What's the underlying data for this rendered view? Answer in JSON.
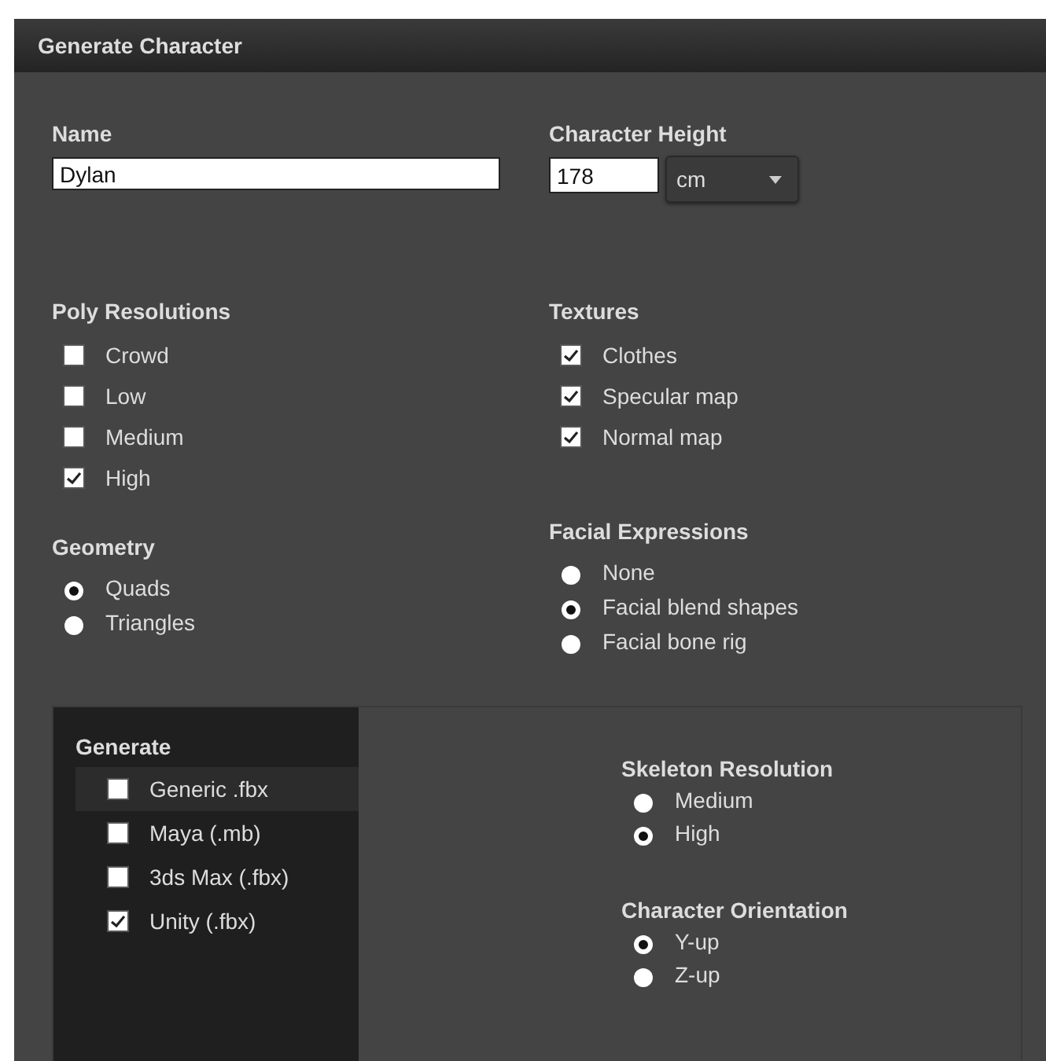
{
  "window": {
    "title": "Generate Character"
  },
  "name": {
    "label": "Name",
    "value": "Dylan"
  },
  "character_height": {
    "label": "Character Height",
    "value": "178",
    "unit": "cm"
  },
  "poly_resolutions": {
    "label": "Poly Resolutions",
    "options": [
      {
        "label": "Crowd",
        "checked": false
      },
      {
        "label": "Low",
        "checked": false
      },
      {
        "label": "Medium",
        "checked": false
      },
      {
        "label": "High",
        "checked": true
      }
    ]
  },
  "textures": {
    "label": "Textures",
    "options": [
      {
        "label": "Clothes",
        "checked": true
      },
      {
        "label": "Specular map",
        "checked": true
      },
      {
        "label": "Normal map",
        "checked": true
      }
    ]
  },
  "geometry": {
    "label": "Geometry",
    "options": [
      {
        "label": "Quads",
        "selected": true
      },
      {
        "label": "Triangles",
        "selected": false
      }
    ]
  },
  "facial_expressions": {
    "label": "Facial Expressions",
    "options": [
      {
        "label": "None",
        "selected": false
      },
      {
        "label": "Facial blend shapes",
        "selected": true
      },
      {
        "label": "Facial bone rig",
        "selected": false
      }
    ]
  },
  "generate": {
    "label": "Generate",
    "items": [
      {
        "label": "Generic .fbx",
        "checked": false,
        "selected": true
      },
      {
        "label": "Maya (.mb)",
        "checked": false,
        "selected": false
      },
      {
        "label": "3ds Max (.fbx)",
        "checked": false,
        "selected": false
      },
      {
        "label": "Unity (.fbx)",
        "checked": true,
        "selected": false
      }
    ]
  },
  "skeleton_resolution": {
    "label": "Skeleton Resolution",
    "options": [
      {
        "label": "Medium",
        "selected": false
      },
      {
        "label": "High",
        "selected": true
      }
    ]
  },
  "character_orientation": {
    "label": "Character Orientation",
    "options": [
      {
        "label": "Y-up",
        "selected": true
      },
      {
        "label": "Z-up",
        "selected": false
      }
    ]
  }
}
